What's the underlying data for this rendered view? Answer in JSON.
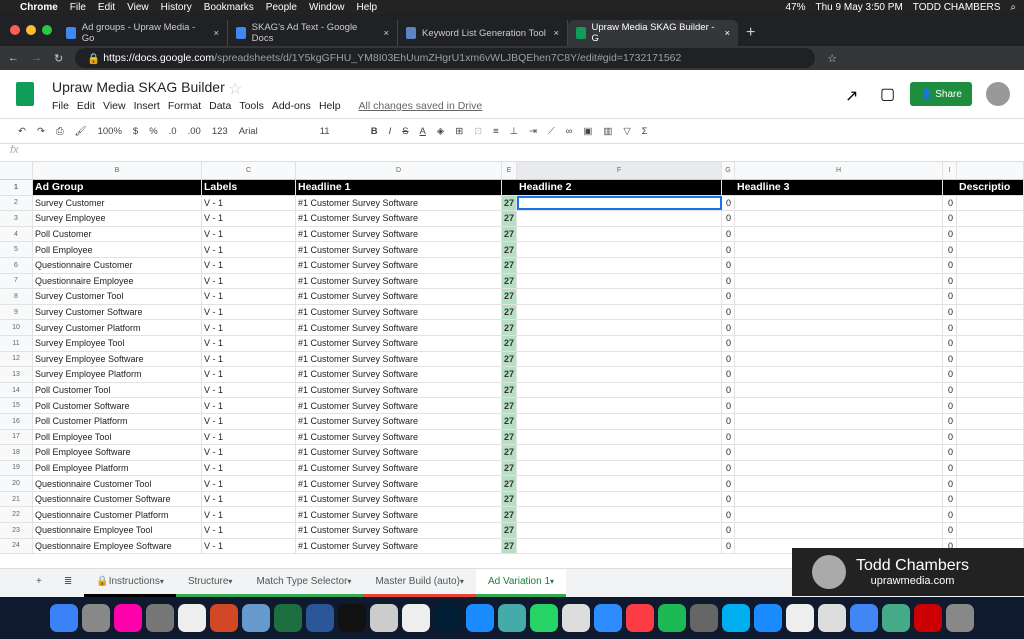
{
  "menubar": {
    "app": "Chrome",
    "items": [
      "File",
      "Edit",
      "View",
      "History",
      "Bookmarks",
      "People",
      "Window",
      "Help"
    ],
    "battery": "47%",
    "datetime": "Thu 9 May  3:50 PM",
    "user": "TODD CHAMBERS"
  },
  "browser": {
    "tabs": [
      {
        "label": "Ad groups - Upraw Media - Go",
        "color": "#4285f4"
      },
      {
        "label": "SKAG's Ad Text - Google Docs",
        "color": "#4285f4"
      },
      {
        "label": "Keyword List Generation Tool",
        "color": "#5f84c6"
      },
      {
        "label": "Upraw Media SKAG Builder - G",
        "color": "#0f9d58"
      }
    ],
    "url_host": "https://docs.google.com",
    "url_path": "/spreadsheets/d/1Y5kgGFHU_YM8I03EhUumZHgrU1xm6vWLJBQEhen7C8Y/edit#gid=1732171562"
  },
  "doc": {
    "title": "Upraw Media SKAG Builder",
    "menus": [
      "File",
      "Edit",
      "View",
      "Insert",
      "Format",
      "Data",
      "Tools",
      "Add-ons",
      "Help"
    ],
    "saved": "All changes saved in Drive",
    "share": "Share"
  },
  "toolbar": {
    "zoom": "100%",
    "currency": "$",
    "percent": "%",
    "dec_less": ".0",
    "dec_more": ".00",
    "format": "123",
    "font": "Arial",
    "size": "11"
  },
  "formula": {
    "fx": "fx"
  },
  "columns": [
    "B",
    "C",
    "D",
    "E",
    "F",
    "G",
    "H",
    "I"
  ],
  "headers": [
    "Ad Group",
    "Labels",
    "Headline 1",
    "",
    "Headline 2",
    "",
    "Headline 3",
    "",
    "Descriptio"
  ],
  "rows": [
    [
      "Survey Customer",
      "V - 1",
      "#1 Customer Survey Software",
      "27",
      "",
      "0",
      "",
      "0"
    ],
    [
      "Survey Employee",
      "V - 1",
      "#1 Customer Survey Software",
      "27",
      "",
      "0",
      "",
      "0"
    ],
    [
      "Poll Customer",
      "V - 1",
      "#1 Customer Survey Software",
      "27",
      "",
      "0",
      "",
      "0"
    ],
    [
      "Poll Employee",
      "V - 1",
      "#1 Customer Survey Software",
      "27",
      "",
      "0",
      "",
      "0"
    ],
    [
      "Questionnaire Customer",
      "V - 1",
      "#1 Customer Survey Software",
      "27",
      "",
      "0",
      "",
      "0"
    ],
    [
      "Questionnaire Employee",
      "V - 1",
      "#1 Customer Survey Software",
      "27",
      "",
      "0",
      "",
      "0"
    ],
    [
      "Survey Customer Tool",
      "V - 1",
      "#1 Customer Survey Software",
      "27",
      "",
      "0",
      "",
      "0"
    ],
    [
      "Survey Customer Software",
      "V - 1",
      "#1 Customer Survey Software",
      "27",
      "",
      "0",
      "",
      "0"
    ],
    [
      "Survey Customer Platform",
      "V - 1",
      "#1 Customer Survey Software",
      "27",
      "",
      "0",
      "",
      "0"
    ],
    [
      "Survey Employee Tool",
      "V - 1",
      "#1 Customer Survey Software",
      "27",
      "",
      "0",
      "",
      "0"
    ],
    [
      "Survey Employee Software",
      "V - 1",
      "#1 Customer Survey Software",
      "27",
      "",
      "0",
      "",
      "0"
    ],
    [
      "Survey Employee Platform",
      "V - 1",
      "#1 Customer Survey Software",
      "27",
      "",
      "0",
      "",
      "0"
    ],
    [
      "Poll Customer Tool",
      "V - 1",
      "#1 Customer Survey Software",
      "27",
      "",
      "0",
      "",
      "0"
    ],
    [
      "Poll Customer Software",
      "V - 1",
      "#1 Customer Survey Software",
      "27",
      "",
      "0",
      "",
      "0"
    ],
    [
      "Poll Customer Platform",
      "V - 1",
      "#1 Customer Survey Software",
      "27",
      "",
      "0",
      "",
      "0"
    ],
    [
      "Poll Employee Tool",
      "V - 1",
      "#1 Customer Survey Software",
      "27",
      "",
      "0",
      "",
      "0"
    ],
    [
      "Poll Employee Software",
      "V - 1",
      "#1 Customer Survey Software",
      "27",
      "",
      "0",
      "",
      "0"
    ],
    [
      "Poll Employee Platform",
      "V - 1",
      "#1 Customer Survey Software",
      "27",
      "",
      "0",
      "",
      "0"
    ],
    [
      "Questionnaire Customer Tool",
      "V - 1",
      "#1 Customer Survey Software",
      "27",
      "",
      "0",
      "",
      "0"
    ],
    [
      "Questionnaire Customer Software",
      "V - 1",
      "#1 Customer Survey Software",
      "27",
      "",
      "0",
      "",
      "0"
    ],
    [
      "Questionnaire Customer Platform",
      "V - 1",
      "#1 Customer Survey Software",
      "27",
      "",
      "0",
      "",
      "0"
    ],
    [
      "Questionnaire Employee Tool",
      "V - 1",
      "#1 Customer Survey Software",
      "27",
      "",
      "0",
      "",
      "0"
    ],
    [
      "Questionnaire Employee Software",
      "V - 1",
      "#1 Customer Survey Software",
      "27",
      "",
      "0",
      "",
      "0"
    ]
  ],
  "sheets": [
    {
      "label": "Instructions",
      "color": "#000000"
    },
    {
      "label": "Structure",
      "color": "#34a853"
    },
    {
      "label": "Match Type Selector",
      "color": "#34a853"
    },
    {
      "label": "Master Build (auto)",
      "color": "#ea4335"
    },
    {
      "label": "Ad Variation 1",
      "color": "#34a853",
      "active": true
    }
  ],
  "overlay": {
    "name": "Todd Chambers",
    "site": "uprawmedia.com"
  }
}
